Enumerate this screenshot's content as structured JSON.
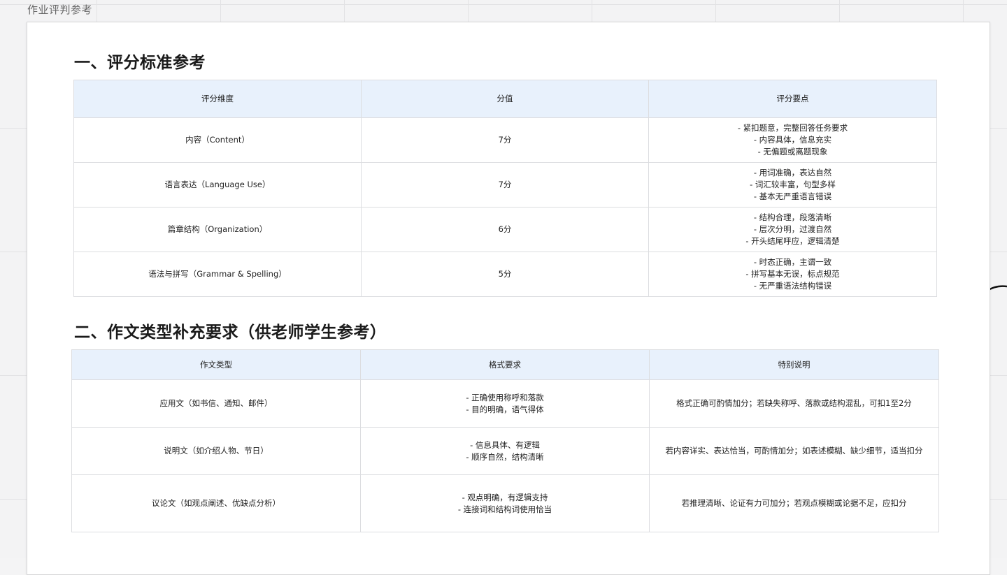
{
  "frame": {
    "title": "作业评判参考"
  },
  "section1": {
    "heading": "一、评分标准参考",
    "headers": [
      "评分维度",
      "分值",
      "评分要点"
    ],
    "rows": [
      {
        "dimension": "内容（Content）",
        "score": "7分",
        "points": [
          "- 紧扣题意，完整回答任务要求",
          "- 内容具体，信息充实",
          "- 无偏题或离题现象"
        ]
      },
      {
        "dimension": "语言表达（Language Use）",
        "score": "7分",
        "points": [
          "- 用词准确，表达自然",
          "- 词汇较丰富，句型多样",
          "- 基本无严重语言错误"
        ]
      },
      {
        "dimension": "篇章结构（Organization）",
        "score": "6分",
        "points": [
          "- 结构合理，段落清晰",
          "- 层次分明，过渡自然",
          "- 开头结尾呼应，逻辑清楚"
        ]
      },
      {
        "dimension": "语法与拼写（Grammar & Spelling）",
        "score": "5分",
        "points": [
          "- 时态正确，主谓一致",
          "- 拼写基本无误，标点规范",
          "- 无严重语法结构错误"
        ]
      }
    ]
  },
  "section2": {
    "heading": "二、作文类型补充要求（供老师学生参考）",
    "headers": [
      "作文类型",
      "格式要求",
      "特别说明"
    ],
    "rows": [
      {
        "type": "应用文（如书信、通知、邮件）",
        "format": [
          "- 正确使用称呼和落款",
          "- 目的明确，语气得体"
        ],
        "note": "格式正确可酌情加分；若缺失称呼、落款或结构混乱，可扣1至2分"
      },
      {
        "type": "说明文（如介绍人物、节日）",
        "format": [
          "- 信息具体、有逻辑",
          "- 顺序自然，结构清晰"
        ],
        "note": "若内容详实、表达恰当，可酌情加分；如表述模糊、缺少细节，适当扣分"
      },
      {
        "type": "议论文（如观点阐述、优缺点分析）",
        "format": [
          "- 观点明确，有逻辑支持",
          "- 连接词和结构词使用恰当"
        ],
        "note": "若推理清晰、论证有力可加分；若观点模糊或论据不足，应扣分"
      }
    ]
  }
}
